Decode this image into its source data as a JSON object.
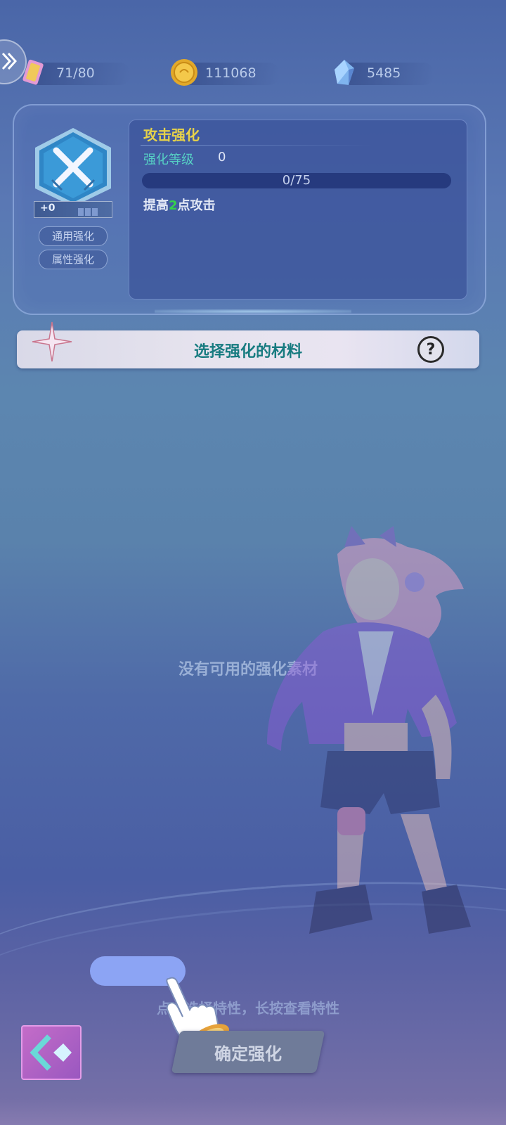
{
  "resources": {
    "stamina": {
      "value": "71/80",
      "icon": "stamina-card-icon"
    },
    "coins": {
      "value": "111068",
      "icon": "gold-coin-icon"
    },
    "crystals": {
      "value": "5485",
      "icon": "crystal-gem-icon"
    }
  },
  "upgrade": {
    "badge_level": "+0",
    "title": "攻击强化",
    "level_label": "强化等级",
    "level_value": "0",
    "progress_text": "0/75",
    "progress_fraction": 0,
    "effect_prefix": "提高",
    "effect_number": "2",
    "effect_suffix": "点攻击",
    "tabs": [
      "通用强化",
      "属性强化"
    ]
  },
  "materials": {
    "title": "选择强化的材料",
    "help_label": "?",
    "empty_message": "没有可用的强化素材"
  },
  "bottom": {
    "hint": "点击选择特性，长按查看特性",
    "confirm_label": "确定强化"
  },
  "colors": {
    "title_yellow": "#e6d24a",
    "level_teal": "#56d0c4",
    "effect_green": "#34d24a",
    "material_title": "#177b80"
  }
}
